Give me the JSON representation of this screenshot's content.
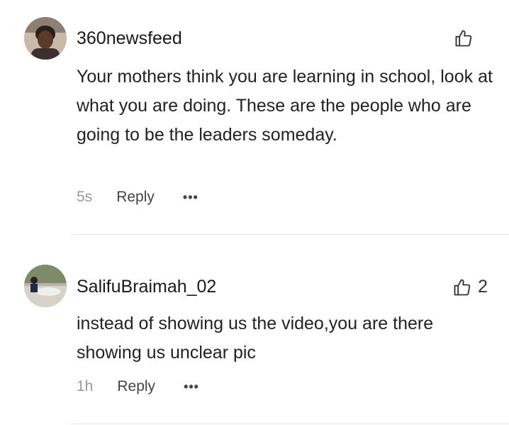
{
  "comments": [
    {
      "username": "360newsfeed",
      "text": "Your mothers think you are learning in school, look at what you are doing. These are the people who are going to be the leaders someday.",
      "time": "5s",
      "reply_label": "Reply",
      "more_label": "•••",
      "likes": "",
      "icons": {
        "avatar": "avatar-photo",
        "like": "thumbs-up-icon",
        "more": "more-options-icon"
      }
    },
    {
      "username": "SalifuBraimah_02",
      "text": "instead of showing us the video,you are there showing us unclear pic",
      "time": "1h",
      "reply_label": "Reply",
      "more_label": "•••",
      "likes": "2",
      "icons": {
        "avatar": "avatar-photo",
        "like": "thumbs-up-icon",
        "more": "more-options-icon"
      }
    }
  ],
  "colors": {
    "text": "#222222",
    "muted": "#9a9a9a",
    "divider": "#e6e6e6",
    "background": "#ffffff"
  }
}
